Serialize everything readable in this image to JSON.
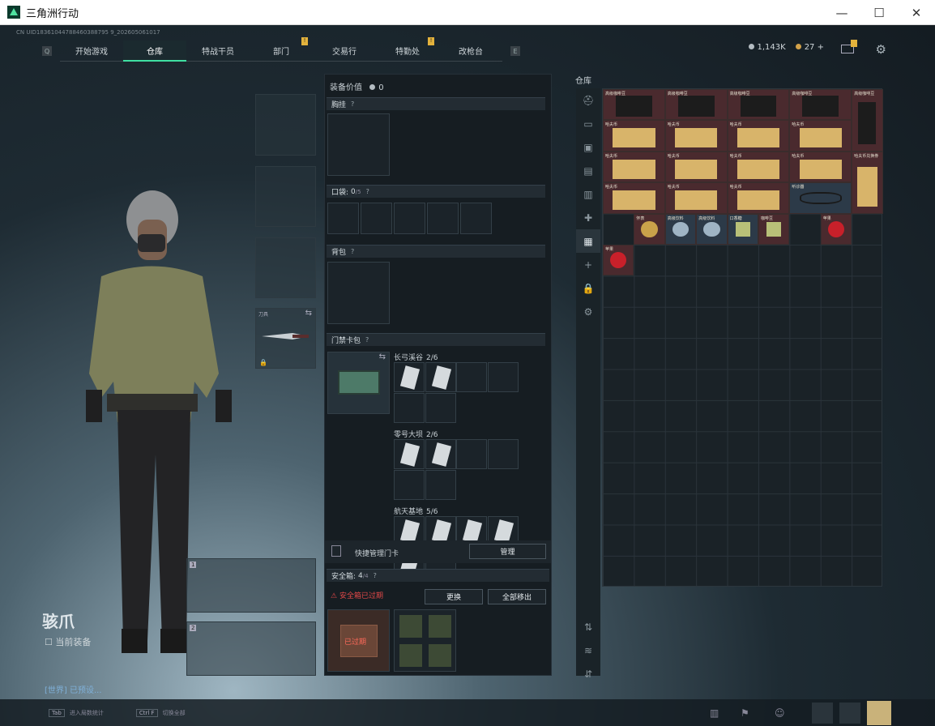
{
  "window": {
    "title": "三角洲行动",
    "minimize": "—",
    "maximize": "☐",
    "close": "✕"
  },
  "uid": "CN UID18361044788460388795 9_202605061017",
  "nav": {
    "left_key": "Q",
    "right_key": "E",
    "tabs": [
      {
        "label": "开始游戏"
      },
      {
        "label": "仓库"
      },
      {
        "label": "特战干员"
      },
      {
        "label": "部门",
        "badge": "!"
      },
      {
        "label": "交易行"
      },
      {
        "label": "特勤处",
        "badge": "!"
      },
      {
        "label": "改枪台"
      }
    ]
  },
  "currency": {
    "silver": "1,143K",
    "coins": "27",
    "plus": "+"
  },
  "player": {
    "name": "骇爪",
    "equip_label": "当前装备"
  },
  "chat": {
    "text": "[世界] 已预设..."
  },
  "bottom": {
    "tab_key": "Tab",
    "tab_hint": "进入局数统计",
    "ctrl_key": "Ctrl F",
    "ctrl_hint": "切换全部"
  },
  "loadout": {
    "knife_label": "刀具",
    "weapon_slot_1": "1",
    "weapon_slot_2": "2"
  },
  "equipment": {
    "value_label": "装备价值",
    "value": "0",
    "chest_label": "胸挂",
    "pocket_label": "口袋:",
    "pocket_count": "0",
    "pocket_max": "/5",
    "backpack_label": "背包",
    "keycard_label": "门禁卡包",
    "keycard_groups": [
      {
        "name": "长弓溪谷",
        "count": "2/6"
      },
      {
        "name": "零号大坝",
        "count": "2/6"
      },
      {
        "name": "航天基地",
        "count": "5/6"
      }
    ],
    "manage_label": "快捷管理门卡",
    "manage_button": "管理",
    "safe_label": "安全箱:",
    "safe_count": "4",
    "safe_max": "/4",
    "safe_expired_warning": "安全箱已过期",
    "replace_button": "更换",
    "move_all_button": "全部移出",
    "safe_expired_tag": "已过期"
  },
  "stash": {
    "label": "仓库",
    "items": [
      {
        "name": "高级咖啡豆",
        "kind": "coffee"
      },
      {
        "name": "高级咖啡豆",
        "kind": "coffee"
      },
      {
        "name": "高级咖啡豆",
        "kind": "coffee"
      },
      {
        "name": "高级咖啡豆",
        "kind": "coffee"
      },
      {
        "name": "高级咖啡豆",
        "kind": "coffee-tall"
      },
      {
        "name": "哈夫币",
        "kind": "cash"
      },
      {
        "name": "哈夫币",
        "kind": "cash"
      },
      {
        "name": "哈夫币",
        "kind": "cash"
      },
      {
        "name": "哈夫币",
        "kind": "cash"
      },
      {
        "name": "哈夫币",
        "kind": "cash"
      },
      {
        "name": "哈夫币",
        "kind": "cash"
      },
      {
        "name": "哈夫币",
        "kind": "cash"
      },
      {
        "name": "哈夫币",
        "kind": "cash"
      },
      {
        "name": "哈夫币兑换券",
        "kind": "cash-tall"
      },
      {
        "name": "哈夫币",
        "kind": "cash"
      },
      {
        "name": "哈夫币",
        "kind": "cash"
      },
      {
        "name": "哈夫币",
        "kind": "cash"
      },
      {
        "name": "听诊器",
        "kind": "stethoscope"
      },
      {
        "name": "怀表",
        "kind": "watch"
      },
      {
        "name": "高级饮料",
        "kind": "can"
      },
      {
        "name": "高级饮料",
        "kind": "can"
      },
      {
        "name": "口香糖",
        "kind": "gum"
      },
      {
        "name": "咖啡豆",
        "kind": "snack"
      },
      {
        "name": "苹果",
        "kind": "apple"
      },
      {
        "name": "苹果",
        "kind": "apple"
      }
    ]
  },
  "colors": {
    "accent": "#3fe0a2",
    "warning": "#e24848",
    "badge": "#e3b23c"
  }
}
